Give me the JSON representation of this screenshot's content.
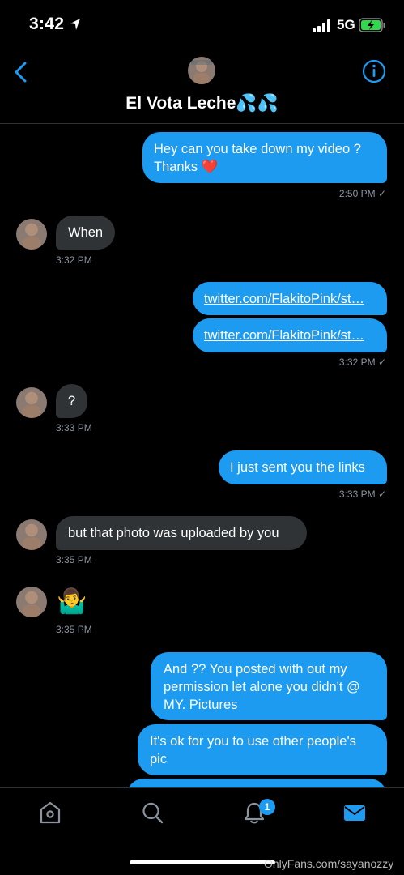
{
  "status_bar": {
    "time": "3:42",
    "network": "5G"
  },
  "header": {
    "contact_name": "El Vota Leche💦💦"
  },
  "messages": [
    {
      "dir": "out",
      "text": "Hey can you take down my video ? Thanks ❤️",
      "time": "2:50 PM ✓"
    },
    {
      "dir": "in",
      "text": "When",
      "time": "3:32 PM"
    },
    {
      "dir": "out",
      "text": "twitter.com/FlakitoPink/st…"
    },
    {
      "dir": "out",
      "text": "twitter.com/FlakitoPink/st…",
      "time": "3:32 PM ✓"
    },
    {
      "dir": "in",
      "text": "?",
      "time": "3:33 PM"
    },
    {
      "dir": "out",
      "text": "I just sent you the links",
      "time": "3:33 PM ✓"
    },
    {
      "dir": "in",
      "text": "but that photo was uploaded by you",
      "time": "3:35 PM"
    },
    {
      "dir": "in",
      "text": "🤷‍♂️",
      "time": "3:35 PM"
    },
    {
      "dir": "out",
      "text": "And ?? You posted with out my permission let alone you didn't @ MY. Pictures"
    },
    {
      "dir": "out",
      "text": "It's ok for you to use other people's pic"
    }
  ],
  "nav": {
    "notification_count": "1"
  },
  "watermark": "OnlyFans.com/sayanozzy",
  "colors": {
    "accent": "#1d9bf0",
    "incoming_bubble": "#2f3336",
    "background": "#000000"
  },
  "icons": [
    "location-arrow-icon",
    "signal-icon",
    "battery-charging-icon",
    "back-chevron-icon",
    "info-icon",
    "home-icon",
    "search-icon",
    "bell-icon",
    "mail-icon"
  ]
}
